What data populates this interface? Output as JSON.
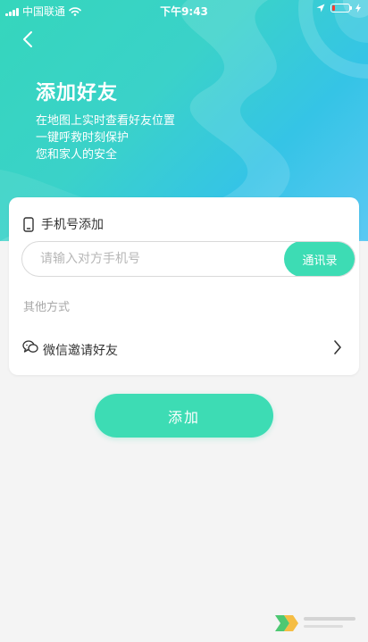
{
  "status_bar": {
    "carrier": "中国联通",
    "time": "下午9:43",
    "battery_level": 0.15
  },
  "header": {
    "title": "添加好友",
    "subtitle_lines": [
      "在地图上实时查看好友位置",
      "一键呼救时刻保护",
      "您和家人的安全"
    ]
  },
  "phone_section": {
    "title": "手机号添加",
    "placeholder": "请输入对方手机号",
    "contacts_button": "通讯录"
  },
  "other_section": {
    "title": "其他方式",
    "wechat_invite": "微信邀请好友"
  },
  "add_button": "添加",
  "colors": {
    "accent": "#3ddcb4",
    "header_start": "#35d6bc",
    "header_end": "#5bc8f3",
    "background": "#f4f4f4"
  },
  "icons": {
    "back": "back-arrow-icon",
    "phone": "mobile-phone-icon",
    "wechat": "wechat-icon",
    "chevron": "chevron-right-icon",
    "wifi": "wifi-icon",
    "location": "location-arrow-icon",
    "battery": "battery-icon",
    "charging": "charging-bolt-icon"
  }
}
